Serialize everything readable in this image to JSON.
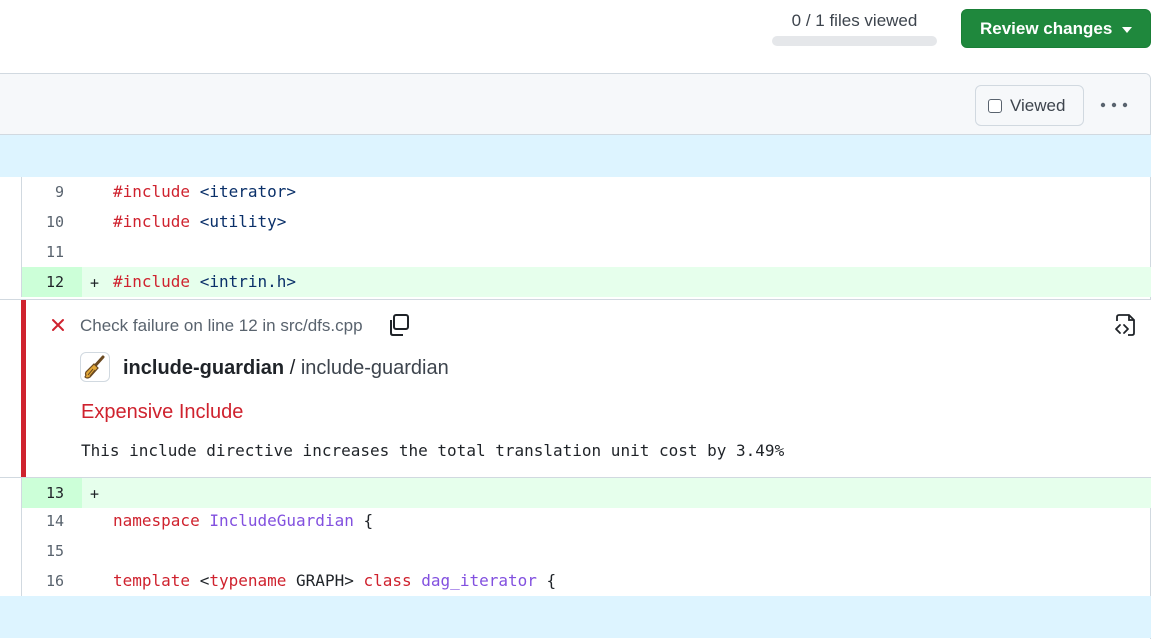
{
  "top_bar": {
    "files_viewed_label": "0 / 1 files viewed",
    "files_viewed_fraction": 0,
    "review_button_label": "Review changes"
  },
  "file_header": {
    "viewed_label": "Viewed",
    "viewed_checked": false
  },
  "diff": {
    "lines": [
      {
        "number": "9",
        "marker": "",
        "type": "context",
        "tokens": [
          {
            "t": "#include",
            "c": "kw"
          },
          {
            "t": " ",
            "c": ""
          },
          {
            "t": "<iterator>",
            "c": "str"
          }
        ]
      },
      {
        "number": "10",
        "marker": "",
        "type": "context",
        "tokens": [
          {
            "t": "#include",
            "c": "kw"
          },
          {
            "t": " ",
            "c": ""
          },
          {
            "t": "<utility>",
            "c": "str"
          }
        ]
      },
      {
        "number": "11",
        "marker": "",
        "type": "context",
        "tokens": []
      },
      {
        "number": "12",
        "marker": "+",
        "type": "added",
        "tokens": [
          {
            "t": "#include",
            "c": "kw"
          },
          {
            "t": " ",
            "c": ""
          },
          {
            "t": "<intrin.h>",
            "c": "str"
          }
        ]
      },
      {
        "number": "13",
        "marker": "+",
        "type": "added",
        "tokens": []
      },
      {
        "number": "14",
        "marker": "",
        "type": "context",
        "tokens": [
          {
            "t": "namespace",
            "c": "kw"
          },
          {
            "t": " ",
            "c": ""
          },
          {
            "t": "IncludeGuardian",
            "c": "ent"
          },
          {
            "t": " {",
            "c": ""
          }
        ]
      },
      {
        "number": "15",
        "marker": "",
        "type": "context",
        "tokens": []
      },
      {
        "number": "16",
        "marker": "",
        "type": "context",
        "tokens": [
          {
            "t": "template",
            "c": "kw"
          },
          {
            "t": " ",
            "c": ""
          },
          {
            "t": "<",
            "c": ""
          },
          {
            "t": "typename",
            "c": "kw"
          },
          {
            "t": " GRAPH> ",
            "c": ""
          },
          {
            "t": "class",
            "c": "kw"
          },
          {
            "t": " ",
            "c": ""
          },
          {
            "t": "dag_iterator",
            "c": "ent"
          },
          {
            "t": " {",
            "c": ""
          }
        ]
      }
    ]
  },
  "annotation": {
    "summary": "Check failure on line 12 in src/dfs.cpp",
    "app_name": "include-guardian",
    "separator": "/",
    "check_name": "include-guardian",
    "title": "Expensive Include",
    "message": "This include directive increases the total translation unit cost by 3.49%",
    "colors": {
      "failure": "#cf222e"
    }
  },
  "icons": {
    "failure": "x-icon",
    "copy": "copy-icon",
    "open": "file-code-icon",
    "app": "broom-icon",
    "more": "kebab-horizontal-icon",
    "review_caret": "triangle-down-icon"
  }
}
